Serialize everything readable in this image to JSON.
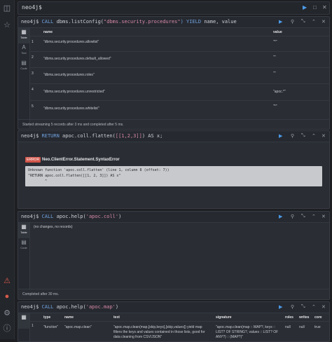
{
  "editor": {
    "prompt": "neo4j$"
  },
  "frames": [
    {
      "query_kw1": "CALL",
      "query_fn": "dbms.listConfig(",
      "query_str": "\"dbms.security.procedures\"",
      "query_kw2": ") YIELD",
      "query_rest": "name, value",
      "prompt": "neo4j$",
      "tabs": [
        "Table",
        "Text",
        "Code"
      ],
      "columns": [
        "name",
        "value"
      ],
      "rows": [
        [
          "\"dbms.security.procedures.allowlist\"",
          "\"*\""
        ],
        [
          "\"dbms.security.procedures.default_allowed\"",
          "\"\""
        ],
        [
          "\"dbms.security.procedures.roles\"",
          "\"\""
        ],
        [
          "\"dbms.security.procedures.unrestricted\"",
          "\"apoc.*\""
        ],
        [
          "\"dbms.security.procedures.whitelist\"",
          "\"*\""
        ]
      ],
      "row_numbers": [
        "1",
        "2",
        "3",
        "4",
        "5"
      ],
      "status": "Started streaming 5 records after 3 ms and completed after 5 ms."
    },
    {
      "prompt": "neo4j$",
      "query_kw1": "RETURN",
      "query_fn": "apoc.coll.flatten(",
      "query_str": "[[1,2,3]]",
      "query_rest": ") AS x;",
      "error_badge": "ERROR",
      "error_title": "Neo.ClientError.Statement.SyntaxError",
      "error_lines": [
        "Unknown function 'apoc.coll.flatten' (line 1, column 8 (offset: 7))",
        "\"RETURN apoc.coll.flatten([[1, 2, 3]]) AS x\"",
        "        ^"
      ]
    },
    {
      "prompt": "neo4j$",
      "query_kw1": "CALL",
      "query_fn": "apoc.help(",
      "query_str": "'apoc.coll'",
      "query_rest": ")",
      "tabs": [
        "Table",
        "Code"
      ],
      "empty_text": "(no changes, no records)",
      "status": "Completed after 30 ms."
    },
    {
      "prompt": "neo4j$",
      "query_kw1": "CALL",
      "query_fn": "apoc.help(",
      "query_str": "'apoc.map'",
      "query_rest": ")",
      "columns": [
        "type",
        "name",
        "text",
        "signature",
        "roles",
        "writes",
        "core"
      ],
      "row": {
        "num": "1",
        "type": "\"function\"",
        "name": "\"apoc.map.clean\"",
        "text": [
          "\"apoc.map.clean(map,[skip,keys],[skip,values]) yield map",
          "filters the keys and values contained in those lists, good for",
          "data cleaning from CSV/JSON\""
        ],
        "signature": [
          "\"apoc.map.clean(map :: MAP?, keys ::",
          "LIST? OF STRING?, values :: LIST? OF",
          "ANY?) :: (MAP?)\""
        ],
        "roles": "null",
        "writes": "null",
        "core": "true"
      }
    }
  ]
}
